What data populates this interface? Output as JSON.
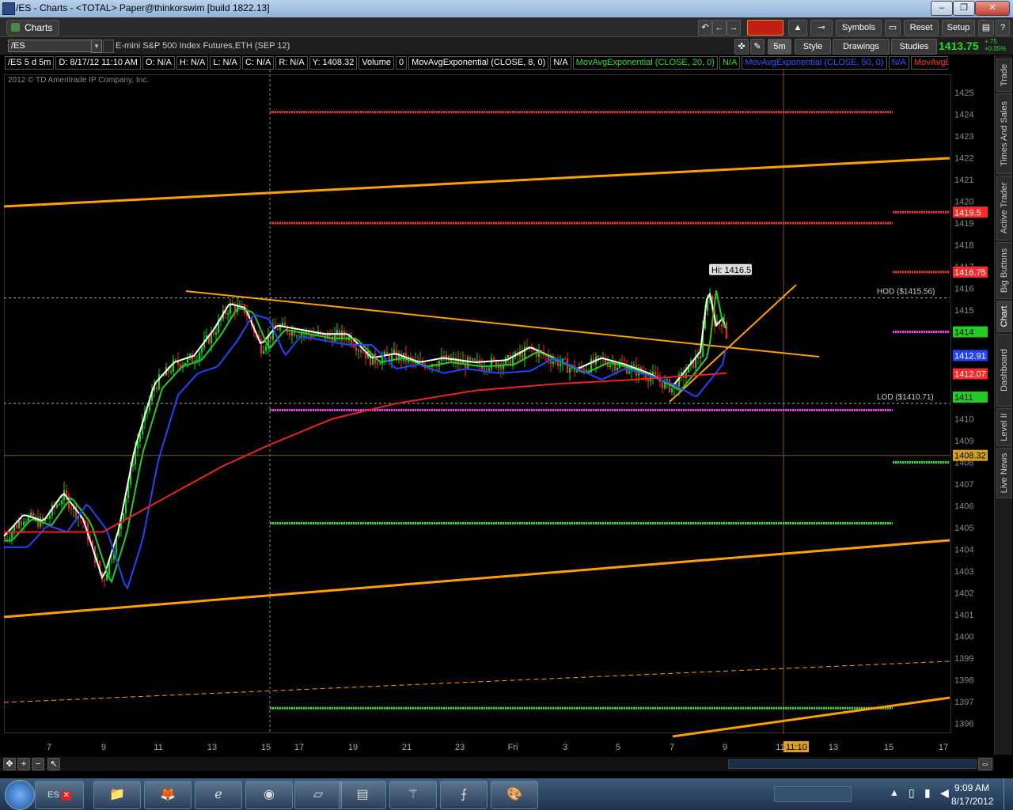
{
  "window": {
    "title": "/ES - Charts - <TOTAL> Paper@thinkorswim [build 1822.13]",
    "controls": [
      "–",
      "❐",
      "✕"
    ]
  },
  "toolbar": {
    "tab_label": "Charts",
    "symbols_label": "Symbols",
    "reset_label": "Reset",
    "setup_label": "Setup"
  },
  "chart_header": {
    "symbol": "/ES",
    "description": "E-mini S&P 500 Index Futures,ETH (SEP 12)",
    "timeframe": "5m",
    "style_label": "Style",
    "drawings_label": "Drawings",
    "studies_label": "Studies",
    "last_price": "1413.75",
    "change": "+.75",
    "change_pct": "+0.05%"
  },
  "study_line": [
    {
      "text": "/ES 5 d 5m",
      "color": "#ffffff"
    },
    {
      "text": "D: 8/17/12 11:10 AM",
      "color": "#ffffff"
    },
    {
      "text": "O: N/A",
      "color": "#ffffff"
    },
    {
      "text": "H: N/A",
      "color": "#ffffff"
    },
    {
      "text": "L: N/A",
      "color": "#ffffff"
    },
    {
      "text": "C: N/A",
      "color": "#ffffff"
    },
    {
      "text": "R: N/A",
      "color": "#ffffff"
    },
    {
      "text": "Y: 1408.32",
      "color": "#ffffff"
    },
    {
      "text": "Volume",
      "color": "#ffffff"
    },
    {
      "text": "0",
      "color": "#ffffff"
    },
    {
      "text": "MovAvgExponential (CLOSE, 8, 0)",
      "color": "#ffffff"
    },
    {
      "text": "N/A",
      "color": "#ffffff"
    },
    {
      "text": "MovAvgExponential (CLOSE, 20, 0)",
      "color": "#33dd33"
    },
    {
      "text": "N/A",
      "color": "#33dd33"
    },
    {
      "text": "MovAvgExponential (CLOSE, 50, 0)",
      "color": "#3355ff"
    },
    {
      "text": "N/A",
      "color": "#3355ff"
    },
    {
      "text": "MovAvgExponential",
      "color": "#ff3333"
    }
  ],
  "copyright": "2012 © TD Ameritrade IP Company, Inc.",
  "sidebar_tabs": [
    "Trade",
    "Times And Sales",
    "Active Trader",
    "Big Buttons",
    "Chart",
    "Dashboard",
    "Level II",
    "Live News"
  ],
  "chart_data": {
    "type": "line",
    "x_tick_labels": [
      "7",
      "9",
      "11",
      "13",
      "15",
      "17",
      "19",
      "21",
      "23",
      "Fri",
      "3",
      "5",
      "7",
      "9",
      "11",
      "13",
      "15",
      "17"
    ],
    "ylim": [
      1395.5,
      1425.5
    ],
    "y_ticks": [
      1396,
      1397,
      1398,
      1399,
      1400,
      1401,
      1402,
      1403,
      1404,
      1405,
      1406,
      1407,
      1408,
      1409,
      1410,
      1411,
      1412,
      1413,
      1414,
      1415,
      1416,
      1417,
      1418,
      1419,
      1420,
      1421,
      1422,
      1423,
      1424,
      1425
    ],
    "annotations": {
      "hi_label": "Hi: 1416.5",
      "hod_label": "HOD ($1415.56)",
      "lod_label": "LOD ($1410.71)",
      "cursor_time": "11:10"
    },
    "price_labels": [
      {
        "text": "1419.5",
        "value": 1419.5,
        "color": "#ff2a2a"
      },
      {
        "text": "1416.75",
        "value": 1416.75,
        "color": "#ff2a2a"
      },
      {
        "text": "1414",
        "value": 1414.0,
        "color": "#22cc22"
      },
      {
        "text": "1412.91",
        "value": 1412.91,
        "color": "#2244ff"
      },
      {
        "text": "1412.07",
        "value": 1412.07,
        "color": "#ff2a2a"
      },
      {
        "text": "1411",
        "value": 1411.0,
        "color": "#22cc22"
      },
      {
        "text": "1408.32",
        "value": 1408.32,
        "color": "#d4a020"
      }
    ],
    "levels": [
      {
        "value": 1424.1,
        "color": "#ff2a2a"
      },
      {
        "value": 1419.0,
        "color": "#ff2a2a"
      },
      {
        "value": 1410.4,
        "color": "#ff33ff"
      },
      {
        "value": 1405.2,
        "color": "#22ee22"
      },
      {
        "value": 1396.7,
        "color": "#22ee22"
      }
    ],
    "ema_series": [
      {
        "name": "EMA 8",
        "color": "#ffffff"
      },
      {
        "name": "EMA 20",
        "color": "#22cc22"
      },
      {
        "name": "EMA 50",
        "color": "#2244ff"
      },
      {
        "name": "EMA 200",
        "color": "#ee2222"
      }
    ],
    "colors": {
      "up": "#00dd00",
      "down": "#ff2020",
      "trendline": "#ffa000",
      "background": "#000000"
    }
  },
  "taskbar": {
    "time": "9:09 AM",
    "date": "8/17/2012",
    "es_button": "ES"
  }
}
